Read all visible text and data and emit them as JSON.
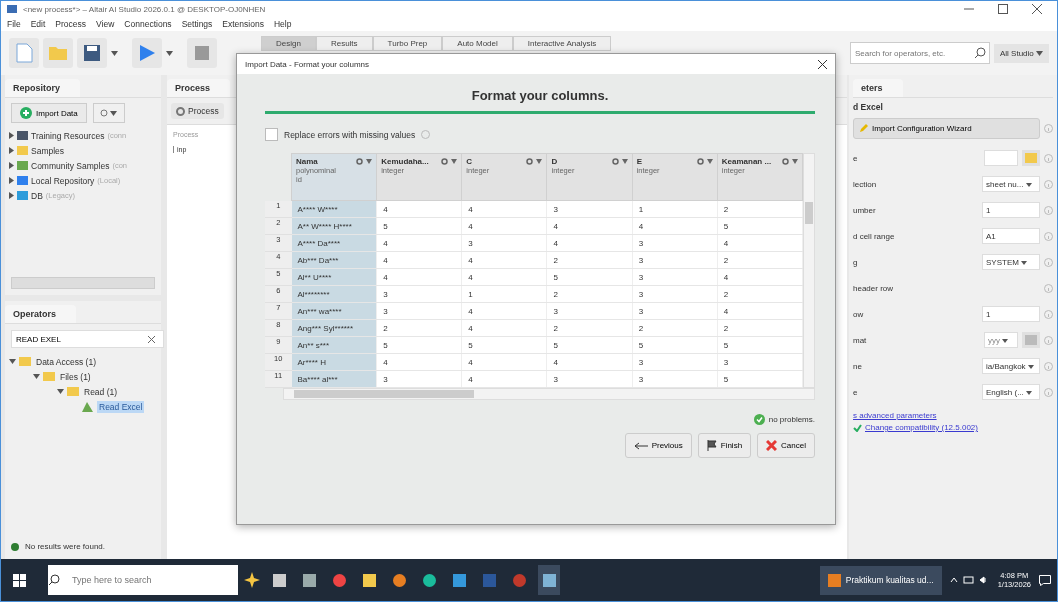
{
  "window": {
    "title": "<new process*> – Altair AI Studio 2026.0.1 @ DESKTOP-OJ0NHEN"
  },
  "menu": [
    "File",
    "Edit",
    "Process",
    "View",
    "Connections",
    "Settings",
    "Extensions",
    "Help"
  ],
  "perspectives": [
    {
      "label": "Design",
      "selected": true
    },
    {
      "label": "Results",
      "selected": false
    },
    {
      "label": "Turbo Prep",
      "selected": false
    },
    {
      "label": "Auto Model",
      "selected": false
    },
    {
      "label": "Interactive Analysis",
      "selected": false
    }
  ],
  "search": {
    "placeholder": "Search for operators, etc."
  },
  "studio_menu": "All Studio",
  "repository": {
    "tab": "Repository",
    "import_button": "Import Data",
    "items": [
      {
        "name": "Training Resources",
        "note": "(conn",
        "kind": "server"
      },
      {
        "name": "Samples",
        "kind": "folder"
      },
      {
        "name": "Community Samples",
        "note": "(con",
        "kind": "community"
      },
      {
        "name": "Local Repository",
        "note": "(Local)",
        "kind": "local"
      },
      {
        "name": "DB",
        "note": "(Legacy)",
        "kind": "db"
      }
    ]
  },
  "operators": {
    "tab": "Operators",
    "search_value": "READ EXEL",
    "tree": [
      {
        "label": "Data Access (1)",
        "kind": "folder",
        "expanded": true,
        "selected": false,
        "children": [
          {
            "label": "Files (1)",
            "kind": "folder",
            "expanded": true,
            "selected": false,
            "children": [
              {
                "label": "Read (1)",
                "kind": "folder",
                "expanded": true,
                "selected": false,
                "children": [
                  {
                    "label": "Read Excel",
                    "kind": "operator",
                    "selected": true
                  }
                ]
              }
            ]
          }
        ]
      }
    ],
    "status": "No results were found."
  },
  "process": {
    "tab": "Process",
    "breadcrumb": "Process",
    "label": "Process",
    "port": "inp"
  },
  "dialog": {
    "title": "Import Data - Format your columns",
    "heading": "Format your columns.",
    "level": 1,
    "replace_errors": {
      "label": "Replace errors with missing values",
      "checked": false
    },
    "columns": [
      {
        "name": "Nama",
        "type": "polynominal",
        "role": "id",
        "selected": true
      },
      {
        "name": "Kemudaha...",
        "type": "integer",
        "selected": false
      },
      {
        "name": "C",
        "type": "integer",
        "selected": false
      },
      {
        "name": "D",
        "type": "integer",
        "selected": false
      },
      {
        "name": "E",
        "type": "integer",
        "selected": false
      },
      {
        "name": "Keamanan ...",
        "type": "integer",
        "selected": false
      }
    ],
    "row_numbers": [
      "1",
      "2",
      "3",
      "4",
      "5",
      "6",
      "7",
      "8",
      "9",
      "10",
      "11"
    ],
    "rows": [
      [
        "A**** W****",
        "4",
        "4",
        "3",
        "1",
        "2"
      ],
      [
        "A** W**** H****",
        "5",
        "4",
        "4",
        "4",
        "5"
      ],
      [
        "A**** Da****",
        "4",
        "3",
        "4",
        "3",
        "4"
      ],
      [
        "Ab*** Da***",
        "4",
        "4",
        "2",
        "3",
        "2"
      ],
      [
        "Al** U****",
        "4",
        "4",
        "5",
        "3",
        "4"
      ],
      [
        "Al********",
        "3",
        "1",
        "2",
        "3",
        "2"
      ],
      [
        "An*** wa****",
        "3",
        "4",
        "3",
        "3",
        "4"
      ],
      [
        "Ang*** Syl******",
        "2",
        "4",
        "2",
        "2",
        "2"
      ],
      [
        "An** s***",
        "5",
        "5",
        "5",
        "5",
        "5"
      ],
      [
        "Ar**** H",
        "4",
        "4",
        "4",
        "3",
        "3"
      ],
      [
        "Ba**** al***",
        "3",
        "4",
        "3",
        "3",
        "5"
      ]
    ],
    "problems": "no problems.",
    "buttons": [
      {
        "label": "Previous",
        "kind": "previous"
      },
      {
        "label": "Finish",
        "kind": "finish"
      },
      {
        "label": "Cancel",
        "kind": "cancel"
      }
    ]
  },
  "parameters": {
    "tab": "eters",
    "operator": "d Excel",
    "wizard_button": "Import Configuration Wizard",
    "rows": [
      {
        "label": "e",
        "kind": "file"
      },
      {
        "label": "lection",
        "kind": "select",
        "value": "sheet nu..."
      },
      {
        "label": "umber",
        "kind": "text",
        "value": "1"
      },
      {
        "label": "d cell range",
        "kind": "text",
        "value": "A1"
      },
      {
        "label": "g",
        "kind": "select",
        "value": "SYSTEM"
      },
      {
        "label": "header row",
        "kind": "none"
      },
      {
        "label": "ow",
        "kind": "text",
        "value": "1"
      },
      {
        "label": "mat",
        "kind": "format",
        "value": "yyy"
      },
      {
        "label": "ne",
        "kind": "select",
        "value": "ia/Bangkok"
      },
      {
        "label": "e",
        "kind": "select",
        "value": "English (..."
      }
    ],
    "advanced_link": "s advanced parameters",
    "compat_link": "Change compatibility (12.5.002)"
  },
  "taskbar": {
    "search_placeholder": "Type here to search",
    "active_app": "Praktikum kualitas ud...",
    "time": "4:08 PM",
    "date": "1/13/2026"
  }
}
